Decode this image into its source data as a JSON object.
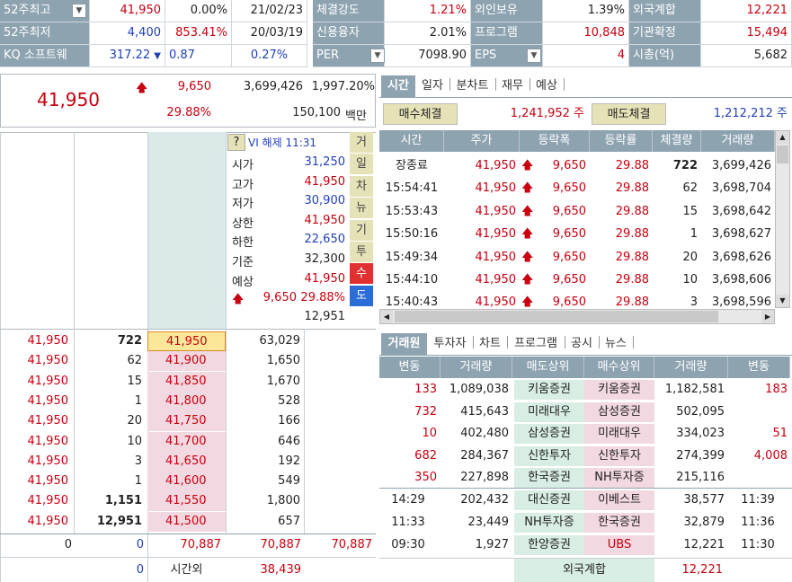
{
  "top": {
    "row1": {
      "label1": "52주최고",
      "v1": "41,950",
      "v2": "0.00%",
      "v3": "21/02/23",
      "label2": "체결강도",
      "v4": "1.21%",
      "label3": "외인보유",
      "v5": "1.39%",
      "label4": "외국계합",
      "v6": "12,221"
    },
    "row2": {
      "label1": "52주최저",
      "v1": "4,400",
      "v2": "853.41%",
      "v3": "20/03/19",
      "label2": "신용융자",
      "v4": "2.01%",
      "label3": "프로그램",
      "v5": "10,848",
      "label4": "기관확정",
      "v6": "15,494"
    },
    "row3": {
      "label1": "KQ 소프트웨",
      "v1": "317.22",
      "v1arrow": "▼",
      "v2": "0.87",
      "v3": "0.27%",
      "label2": "PER",
      "v4": "7098.90",
      "label3": "EPS",
      "v5": "4",
      "label4": "시총(억)",
      "v6": "5,682"
    }
  },
  "price": {
    "current": "41,950",
    "arrow": "🡅",
    "change": "9,650",
    "volume": "3,699,426",
    "ratio": "1,997.20%",
    "rate": "29.88%",
    "amount": "150,100",
    "amount_unit": "백만"
  },
  "vi": {
    "q": "?",
    "text": "VI 해제 11:31"
  },
  "summary": [
    {
      "label": "시가",
      "value": "31,250",
      "color": "blue"
    },
    {
      "label": "고가",
      "value": "41,950",
      "color": "red"
    },
    {
      "label": "저가",
      "value": "30,900",
      "color": "blue"
    },
    {
      "label": "상한",
      "value": "41,950",
      "color": "red"
    },
    {
      "label": "하한",
      "value": "22,650",
      "color": "blue"
    },
    {
      "label": "기준",
      "value": "32,300",
      "color": "blk"
    },
    {
      "label": "예상",
      "value": "41,950",
      "color": "red"
    }
  ],
  "expected": {
    "arrow": "🡅",
    "change": "9,650",
    "rate": "29.88%",
    "volume": "12,951"
  },
  "side_buttons": [
    "거",
    "일",
    "차",
    "뉴",
    "기",
    "투",
    "수",
    "도"
  ],
  "bids": [
    {
      "p": "41,950",
      "q": "722",
      "price": "41,950",
      "rem": "63,029"
    },
    {
      "p": "41,950",
      "q": "62",
      "price": "41,900",
      "rem": "1,650"
    },
    {
      "p": "41,950",
      "q": "15",
      "price": "41,850",
      "rem": "1,670"
    },
    {
      "p": "41,950",
      "q": "1",
      "price": "41,800",
      "rem": "528"
    },
    {
      "p": "41,950",
      "q": "20",
      "price": "41,750",
      "rem": "166"
    },
    {
      "p": "41,950",
      "q": "10",
      "price": "41,700",
      "rem": "646"
    },
    {
      "p": "41,950",
      "q": "3",
      "price": "41,650",
      "rem": "192"
    },
    {
      "p": "41,950",
      "q": "1",
      "price": "41,600",
      "rem": "549"
    },
    {
      "p": "41,950",
      "q": "1,151",
      "price": "41,550",
      "rem": "1,800"
    },
    {
      "p": "41,950",
      "q": "12,951",
      "price": "41,500",
      "rem": "657"
    }
  ],
  "ob_total": {
    "a": "0",
    "b": "0",
    "c": "70,887",
    "d": "70,887",
    "e": "70,887"
  },
  "ob_after": {
    "b": "0",
    "label": "시간외",
    "d": "38,439"
  },
  "tabs_top": [
    "시간",
    "일자",
    "분차트",
    "재무",
    "예상"
  ],
  "exec": {
    "buy_label": "매수체결",
    "buy_value": "1,241,952 주",
    "sell_label": "매도체결",
    "sell_value": "1,212,212 주"
  },
  "tick_headers": [
    "시간",
    "주가",
    "등락폭",
    "등락률",
    "체결량",
    "거래량"
  ],
  "ticks": [
    {
      "t": "장종료",
      "p": "41,950",
      "ch": "9,650",
      "r": "29.88",
      "q": "722",
      "v": "3,699,426"
    },
    {
      "t": "15:54:41",
      "p": "41,950",
      "ch": "9,650",
      "r": "29.88",
      "q": "62",
      "v": "3,698,704"
    },
    {
      "t": "15:53:43",
      "p": "41,950",
      "ch": "9,650",
      "r": "29.88",
      "q": "15",
      "v": "3,698,642"
    },
    {
      "t": "15:50:16",
      "p": "41,950",
      "ch": "9,650",
      "r": "29.88",
      "q": "1",
      "v": "3,698,627"
    },
    {
      "t": "15:49:34",
      "p": "41,950",
      "ch": "9,650",
      "r": "29.88",
      "q": "20",
      "v": "3,698,626"
    },
    {
      "t": "15:44:10",
      "p": "41,950",
      "ch": "9,650",
      "r": "29.88",
      "q": "10",
      "v": "3,698,606"
    },
    {
      "t": "15:40:43",
      "p": "41,950",
      "ch": "9,650",
      "r": "29.88",
      "q": "3",
      "v": "3,698,596"
    }
  ],
  "tabs_bottom": [
    "거래원",
    "투자자",
    "차트",
    "프로그램",
    "공시",
    "뉴스"
  ],
  "broker_headers": [
    "변동",
    "거래량",
    "매도상위",
    "매수상위",
    "거래량",
    "변동"
  ],
  "brokers": [
    {
      "c1": "133",
      "v1": "1,089,038",
      "sell": "키움증권",
      "buy": "키움증권",
      "v2": "1,182,581",
      "c2": "183"
    },
    {
      "c1": "732",
      "v1": "415,643",
      "sell": "미래대우",
      "buy": "삼성증권",
      "v2": "502,095",
      "c2": ""
    },
    {
      "c1": "10",
      "v1": "402,480",
      "sell": "삼성증권",
      "buy": "미래대우",
      "v2": "334,023",
      "c2": "51"
    },
    {
      "c1": "682",
      "v1": "284,367",
      "sell": "신한투자",
      "buy": "신한투자",
      "v2": "274,399",
      "c2": "4,008"
    },
    {
      "c1": "350",
      "v1": "227,898",
      "sell": "한국증권",
      "buy": "NH투자증",
      "v2": "215,116",
      "c2": ""
    }
  ],
  "broker_times": [
    {
      "t1": "14:29",
      "v1": "202,432",
      "sell": "대신증권",
      "buy": "이베스트",
      "v2": "38,577",
      "t2": "11:39"
    },
    {
      "t1": "11:33",
      "v1": "23,449",
      "sell": "NH투자증",
      "buy": "한국증권",
      "v2": "32,879",
      "t2": "11:36"
    },
    {
      "t1": "09:30",
      "v1": "1,927",
      "sell": "한양증권",
      "buy": "UBS",
      "v2": "12,221",
      "t2": "11:30"
    }
  ],
  "foreign_total": {
    "label": "외국계합",
    "value": "12,221"
  },
  "colors": {
    "header": "#8ea3b0",
    "up": "#c8000f",
    "down": "#1f3fb8",
    "bid_bg": "#f2d8e0",
    "ask_bg": "#d8eee4",
    "price_col": "#dbe9e8"
  }
}
